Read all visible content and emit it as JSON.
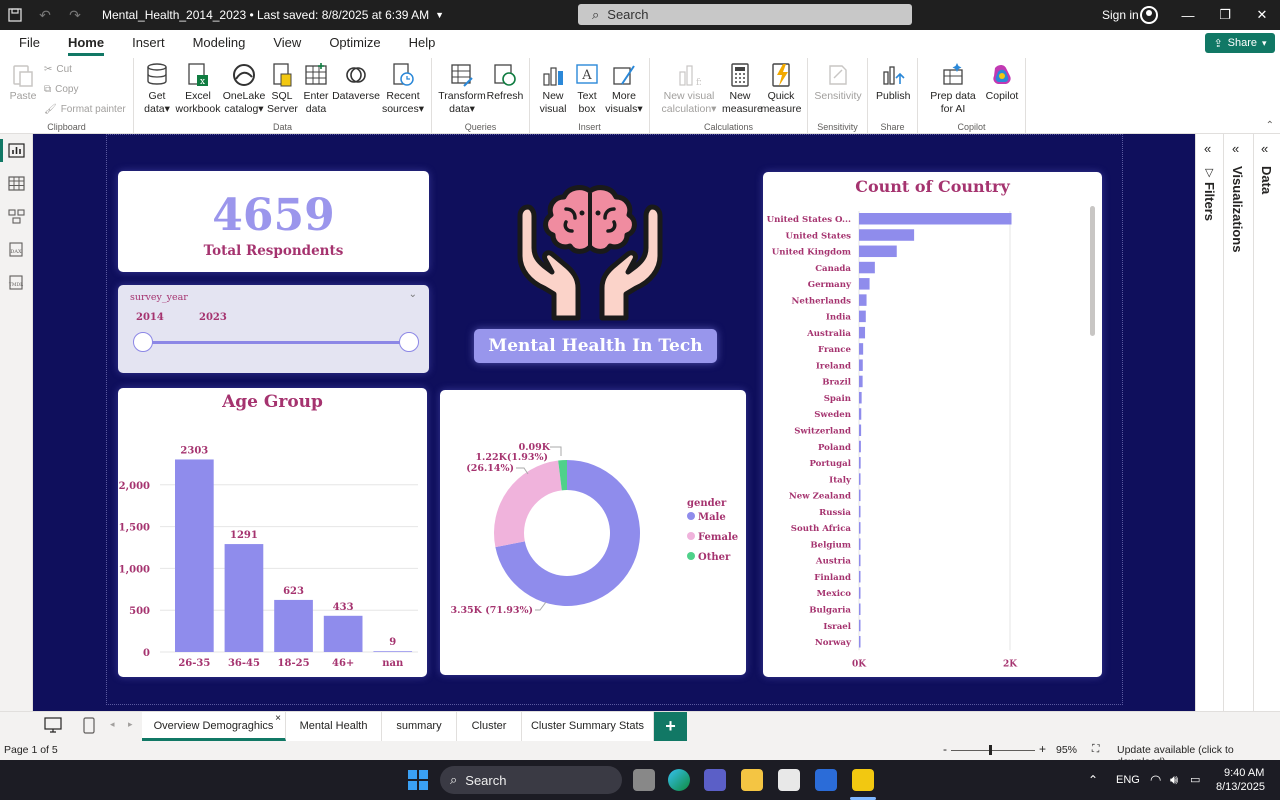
{
  "titlebar": {
    "title": "Mental_Health_2014_2023 • Last saved: 8/8/2025 at 6:39 AM",
    "search_placeholder": "Search",
    "signin": "Sign in"
  },
  "menu": {
    "items": [
      "File",
      "Home",
      "Insert",
      "Modeling",
      "View",
      "Optimize",
      "Help"
    ],
    "share": "Share"
  },
  "ribbon": {
    "clipboard": {
      "paste": "Paste",
      "cut": "Cut",
      "copy": "Copy",
      "format_painter": "Format painter",
      "label": "Clipboard"
    },
    "data": {
      "get_data": "Get data",
      "excel": "Excel workbook",
      "onelake": "OneLake catalog",
      "sql": "SQL Server",
      "enter": "Enter data",
      "dataverse": "Dataverse",
      "recent": "Recent sources",
      "label": "Data"
    },
    "queries": {
      "transform": "Transform data",
      "refresh": "Refresh",
      "label": "Queries"
    },
    "insert": {
      "new_visual": "New visual",
      "text_box": "Text box",
      "more_visuals": "More visuals",
      "label": "Insert"
    },
    "calculations": {
      "new_visual_calc": "New visual calculation",
      "new_measure": "New measure",
      "quick_measure": "Quick measure",
      "label": "Calculations"
    },
    "sensitivity": {
      "btn": "Sensitivity",
      "label": "Sensitivity"
    },
    "share": {
      "publish": "Publish",
      "label": "Share"
    },
    "copilot": {
      "prep": "Prep data for AI",
      "copilot": "Copilot",
      "label": "Copilot"
    }
  },
  "kpi": {
    "value": "4659",
    "label": "Total Respondents"
  },
  "slicer": {
    "title": "survey_year",
    "min": "2014",
    "max": "2023",
    "value_range": [
      2014,
      2023
    ]
  },
  "report_title": "Mental Health In Tech",
  "chart_data": [
    {
      "type": "bar",
      "title": "Age Group",
      "categories": [
        "26-35",
        "36-45",
        "18-25",
        "46+",
        "nan"
      ],
      "values": [
        2303,
        1291,
        623,
        433,
        9
      ],
      "data_labels": [
        "2303",
        "1291",
        "623",
        "433",
        "9"
      ],
      "y_ticks": [
        "0",
        "500",
        "1,000",
        "1,500",
        "2,000"
      ],
      "ylim": [
        0,
        2500
      ],
      "grid": true,
      "color": "#8f8cec"
    },
    {
      "type": "pie",
      "donut": true,
      "legend_title": "gender",
      "legend_position": "right",
      "series": [
        {
          "name": "Male",
          "value": 3.35,
          "label": "3.35K (71.93%)",
          "color": "#8f8cec"
        },
        {
          "name": "Female",
          "value": 1.22,
          "label": "1.22K(1.93%)\n(26.14%)",
          "color": "#f0b3dc"
        },
        {
          "name": "Other",
          "value": 0.09,
          "label": "0.09K",
          "color": "#4fd18a"
        }
      ],
      "labels": {
        "male": "3.35K (71.93%)",
        "female_top": "1.22K(1.93%)",
        "female_bottom": "(26.14%)",
        "other": "0.09K"
      }
    },
    {
      "type": "bar",
      "orientation": "horizontal",
      "title": "Count of Country",
      "categories": [
        "United States O...",
        "United States",
        "United Kingdom",
        "Canada",
        "Germany",
        "Netherlands",
        "India",
        "Australia",
        "France",
        "Ireland",
        "Brazil",
        "Spain",
        "Sweden",
        "Switzerland",
        "Poland",
        "Portugal",
        "Italy",
        "New Zealand",
        "Russia",
        "South Africa",
        "Belgium",
        "Austria",
        "Finland",
        "Mexico",
        "Bulgaria",
        "Israel",
        "Norway"
      ],
      "values": [
        2020,
        730,
        500,
        210,
        140,
        100,
        90,
        80,
        55,
        50,
        48,
        35,
        30,
        28,
        25,
        22,
        20,
        18,
        15,
        14,
        13,
        12,
        10,
        9,
        8,
        7,
        6
      ],
      "x_ticks": [
        "0K",
        "2K"
      ],
      "xlim": [
        0,
        2000
      ],
      "color": "#8f8cec"
    }
  ],
  "panes": {
    "filters": "Filters",
    "visualizations": "Visualizations",
    "data": "Data"
  },
  "tabs": [
    "Overview Demograghics",
    "Mental Health",
    "summary",
    "Cluster",
    "Cluster Summary Stats"
  ],
  "status": {
    "page": "Page 1 of 5",
    "zoom": "95%",
    "update": "Update available (click to download)"
  },
  "taskbar": {
    "search": "Search",
    "lang": "ENG",
    "time": "9:40 AM",
    "date": "8/13/2025"
  }
}
